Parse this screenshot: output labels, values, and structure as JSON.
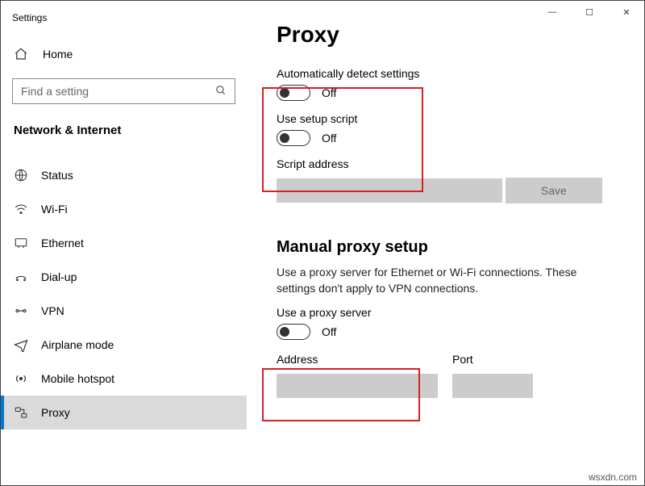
{
  "window": {
    "title": "Settings",
    "minimize_glyph": "—",
    "maximize_glyph": "☐",
    "close_glyph": "✕"
  },
  "sidebar": {
    "home_label": "Home",
    "search_placeholder": "Find a setting",
    "category_label": "Network & Internet",
    "items": [
      {
        "label": "Status",
        "active": false
      },
      {
        "label": "Wi-Fi",
        "active": false
      },
      {
        "label": "Ethernet",
        "active": false
      },
      {
        "label": "Dial-up",
        "active": false
      },
      {
        "label": "VPN",
        "active": false
      },
      {
        "label": "Airplane mode",
        "active": false
      },
      {
        "label": "Mobile hotspot",
        "active": false
      },
      {
        "label": "Proxy",
        "active": true
      }
    ]
  },
  "main": {
    "page_title": "Proxy",
    "auto_detect_label": "Automatically detect settings",
    "auto_detect_state": "Off",
    "setup_script_label": "Use setup script",
    "setup_script_state": "Off",
    "script_address_label": "Script address",
    "script_address_value": "",
    "save_label": "Save",
    "manual_heading": "Manual proxy setup",
    "manual_body": "Use a proxy server for Ethernet or Wi-Fi connections. These settings don't apply to VPN connections.",
    "use_proxy_label": "Use a proxy server",
    "use_proxy_state": "Off",
    "address_label": "Address",
    "address_value": "",
    "port_label": "Port",
    "port_value": ""
  },
  "watermark": "wsxdn.com"
}
